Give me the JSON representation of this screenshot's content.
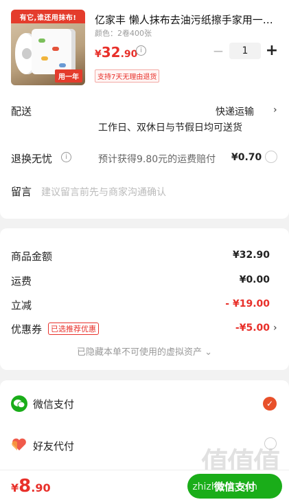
{
  "product": {
    "image_banner": "有它,谁还用抹布!",
    "image_badge": "用一年",
    "title": "亿家丰 懒人抹布去油污纸擦手家用一…",
    "spec": "颜色：2卷400张",
    "price_symbol": "¥",
    "price_int": "32",
    "price_dec": ".90",
    "quantity": "1",
    "minus": "−",
    "plus": "+",
    "return_badge": "支持7天无理由退货"
  },
  "delivery": {
    "label": "配送",
    "method": "快递运输",
    "note": "工作日、双休日与节假日均可送货"
  },
  "return_insurance": {
    "label": "退换无忧",
    "note": "预计获得9.80元的运费赔付",
    "price": "¥0.70"
  },
  "message": {
    "label": "留言",
    "placeholder": "建议留言前先与商家沟通确认"
  },
  "summary": {
    "goods_label": "商品金额",
    "goods_value": "¥32.90",
    "shipping_label": "运费",
    "shipping_value": "¥0.00",
    "discount_label": "立减",
    "discount_value": "- ¥19.00",
    "coupon_label": "优惠券",
    "coupon_badge": "已选推荐优惠",
    "coupon_value": "-¥5.00",
    "hidden_note": "已隐藏本单不可使用的虚拟资产 ⌄"
  },
  "payment": {
    "wechat_label": "微信支付",
    "friend_label": "好友代付"
  },
  "footer": {
    "total_symbol": "¥",
    "total_int": "8",
    "total_dec": ".90",
    "pay_button": "微信支付"
  },
  "watermark": {
    "main": "值值值",
    "sub": "zhizhizhi.com"
  },
  "colors": {
    "accent_red": "#e8302a",
    "wechat_green": "#1aad19"
  }
}
